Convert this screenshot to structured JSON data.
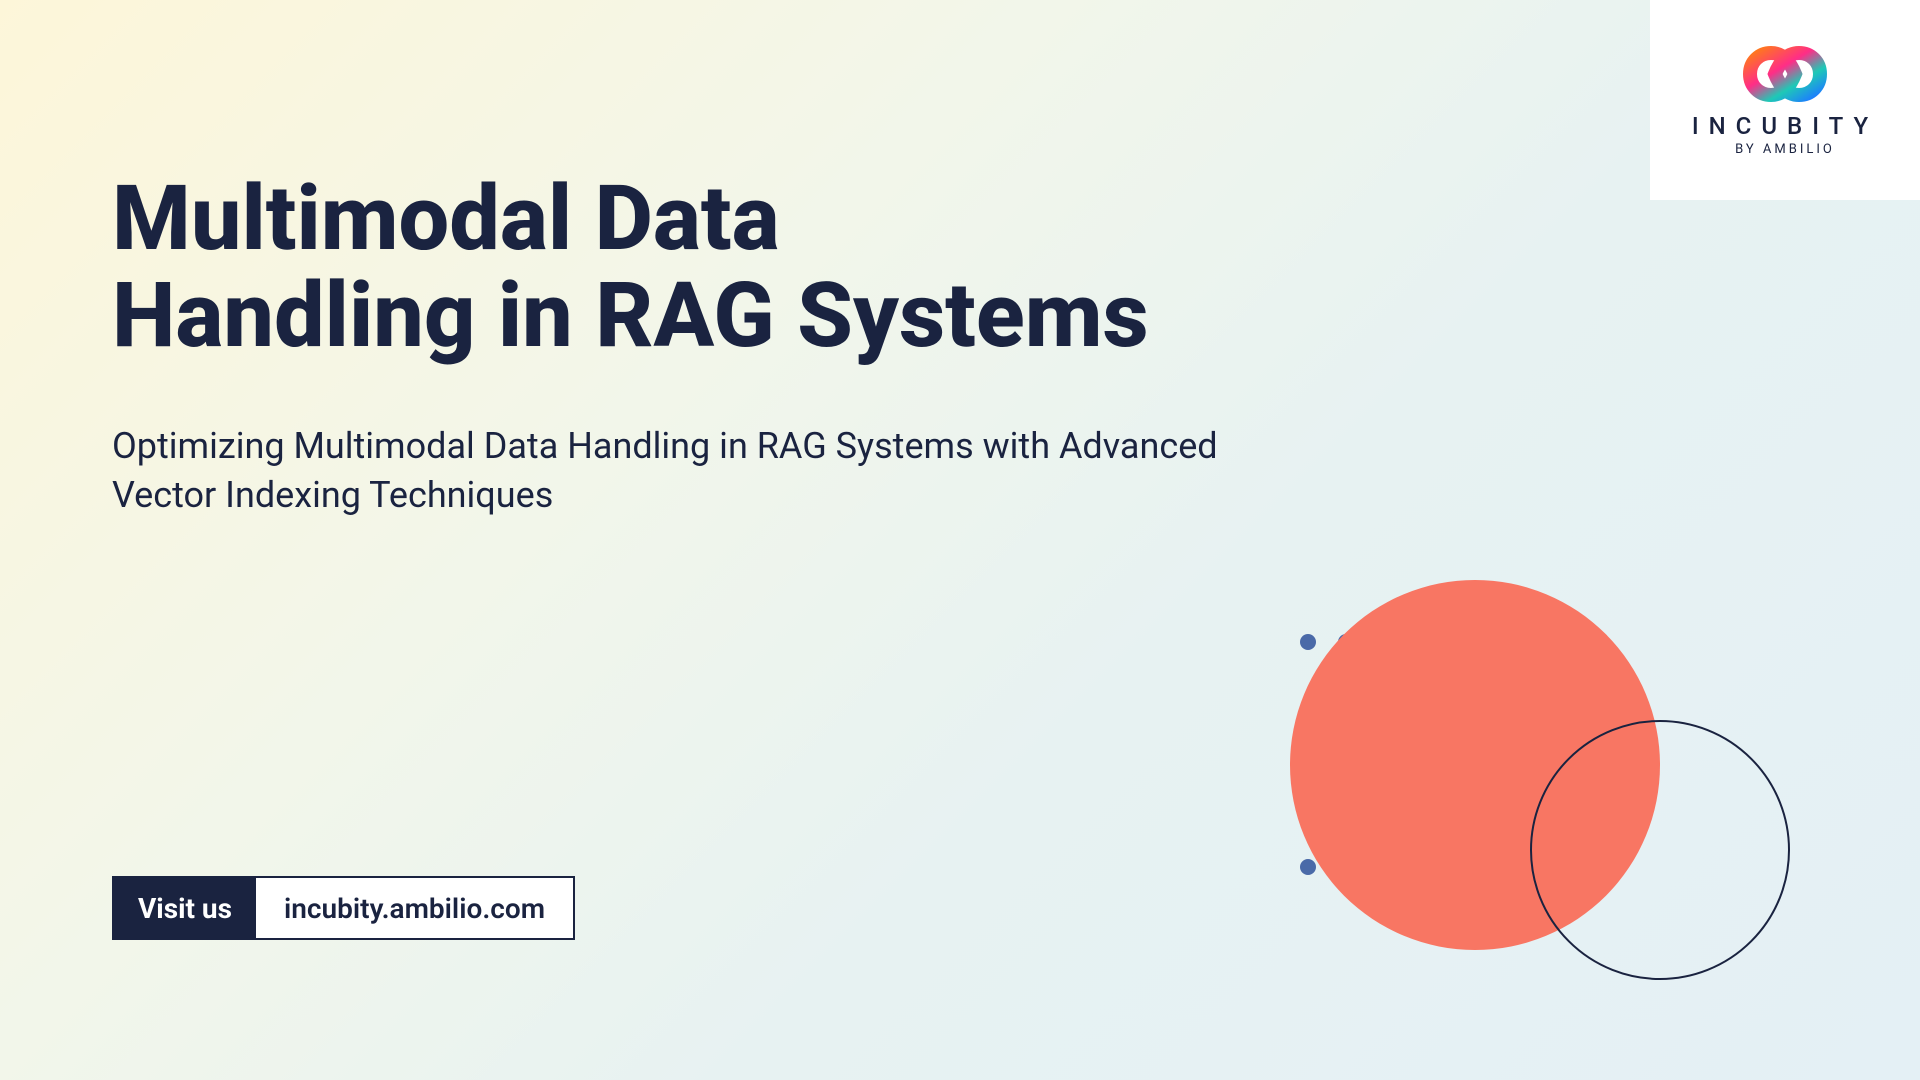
{
  "logo": {
    "brand": "INCUBITY",
    "byline": "BY AMBILIO"
  },
  "title_line1": "Multimodal Data",
  "title_line2": "Handling in RAG Systems",
  "subtitle": "Optimizing Multimodal Data Handling in RAG Systems with Advanced Vector Indexing Techniques",
  "visit": {
    "label": "Visit us",
    "url": "incubity.ambilio.com"
  },
  "colors": {
    "primary_text": "#1a2340",
    "accent_circle": "#f87663",
    "dot": "#4a6aa8"
  }
}
